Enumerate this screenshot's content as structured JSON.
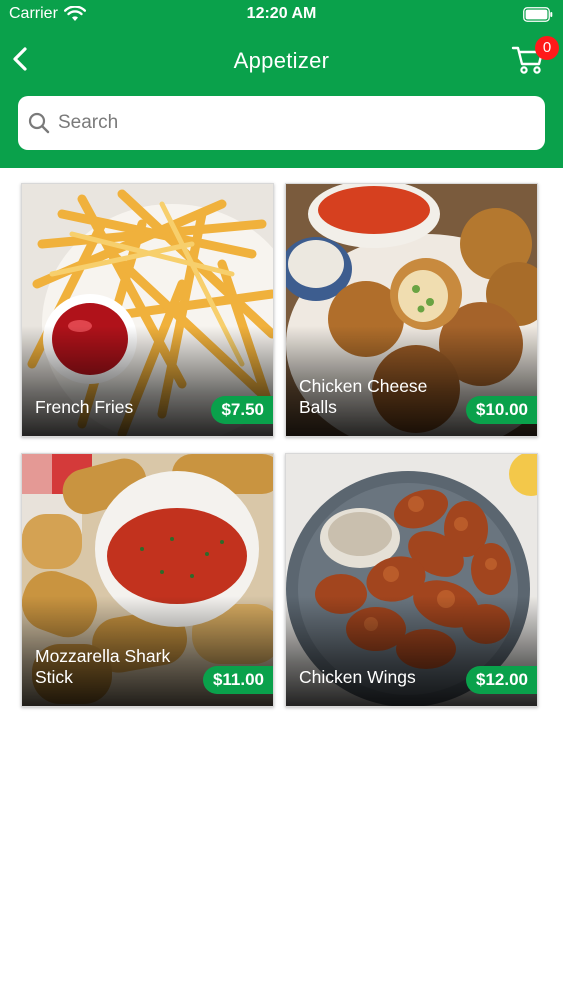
{
  "status_bar": {
    "carrier": "Carrier",
    "time": "12:20 AM"
  },
  "nav": {
    "title": "Appetizer",
    "cart_count": "0"
  },
  "search": {
    "placeholder": "Search",
    "value": ""
  },
  "items": [
    {
      "name": "French Fries",
      "price": "$7.50"
    },
    {
      "name": "Chicken Cheese Balls",
      "price": "$10.00"
    },
    {
      "name": "Mozzarella Shark Stick",
      "price": "$11.00"
    },
    {
      "name": "Chicken Wings",
      "price": "$12.00"
    }
  ],
  "colors": {
    "brand": "#0aa14b",
    "badge": "#ff1a1a"
  },
  "icons": [
    "wifi-icon",
    "battery-icon",
    "back-icon",
    "cart-icon",
    "search-icon"
  ]
}
